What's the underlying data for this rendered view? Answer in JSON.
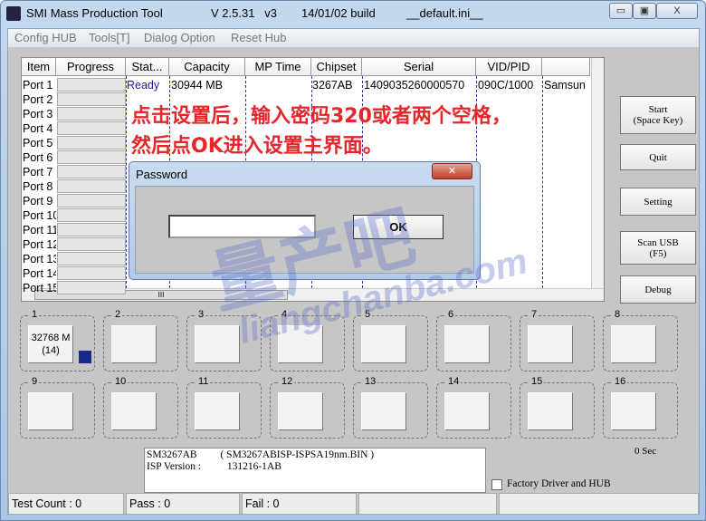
{
  "window": {
    "title": "SMI Mass Production Tool",
    "version": "V 2.5.31   v3",
    "build": "14/01/02 build",
    "ini": "__default.ini__",
    "minimize": "▭",
    "maximize": "▣",
    "close": "X"
  },
  "menu": [
    "Config HUB",
    "Tools[T]",
    "Dialog Option",
    "Reset Hub"
  ],
  "table": {
    "headers": [
      "Item",
      "Progress",
      "Stat...",
      "Capacity",
      "MP Time",
      "Chipset",
      "Serial",
      "VID/PID",
      ""
    ],
    "ports": [
      "Port 1",
      "Port 2",
      "Port 3",
      "Port 4",
      "Port 5",
      "Port 6",
      "Port 7",
      "Port 8",
      "Port 9",
      "Port 10",
      "Port 11",
      "Port 12",
      "Port 13",
      "Port 14",
      "Port 15"
    ],
    "row1": {
      "status": "Ready",
      "capacity": "30944 MB",
      "chipset": "3267AB",
      "serial": "1409035260000570",
      "vidpid": "090C/1000",
      "vendor": "Samsun"
    },
    "hscroll_thumb": "III"
  },
  "buttons": {
    "start": "Start",
    "start_sub": "(Space Key)",
    "quit": "Quit",
    "setting": "Setting",
    "scan": "Scan USB",
    "scan_sub": "(F5)",
    "debug": "Debug"
  },
  "port_groups": [
    "1",
    "2",
    "3",
    "4",
    "5",
    "6",
    "7",
    "8",
    "9",
    "10",
    "11",
    "12",
    "13",
    "14",
    "15",
    "16"
  ],
  "port1_info": {
    "capacity": "32768 M",
    "count": "(14)"
  },
  "info": {
    "line1": "SM3267AB         ( SM3267ABISP-ISPSA19nm.BIN )",
    "line2": "ISP Version :          131216-1AB"
  },
  "timer": "0 Sec",
  "factory_checkbox": "Factory Driver and HUB",
  "statusbar": {
    "test_count": "Test Count : 0",
    "pass": "Pass : 0",
    "fail": "Fail : 0"
  },
  "dialog": {
    "title": "Password",
    "input_value": "",
    "ok": "OK",
    "close": "✕"
  },
  "annotation": {
    "line1": "点击设置后，输入密码320或者两个空格，",
    "line2": "然后点OK进入设置主界面。"
  },
  "watermark": {
    "cn": "量产吧",
    "url": "liangchanba.com"
  }
}
